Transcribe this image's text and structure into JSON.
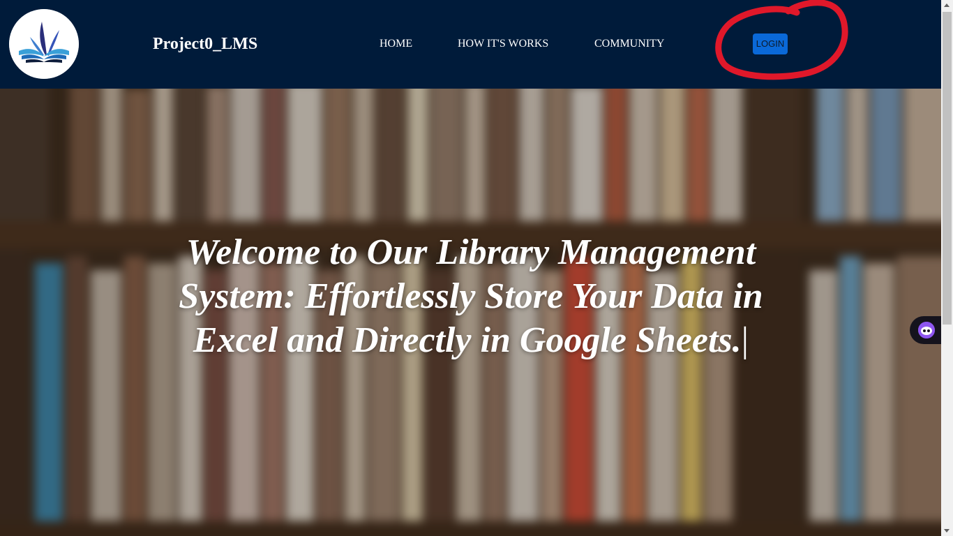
{
  "header": {
    "brand": "Project0_LMS",
    "nav": {
      "home": "HOME",
      "how_it_works": "HOW IT'S WORKS",
      "community": "COMMUNITY"
    },
    "login_label": "LOGIN"
  },
  "hero": {
    "title": "Welcome to Our Library Management System: Effortlessly Store Your Data in Excel and Directly in Google Sheets.",
    "caret": "|"
  },
  "colors": {
    "navbar_bg": "#001b3a",
    "login_bg": "#0a69d8",
    "annotation": "#e0182a",
    "widget_bg": "#15131d",
    "widget_accent": "#8e56f0"
  },
  "icons": {
    "logo": "open-book-logo-icon",
    "widget": "chat-assistant-icon"
  }
}
